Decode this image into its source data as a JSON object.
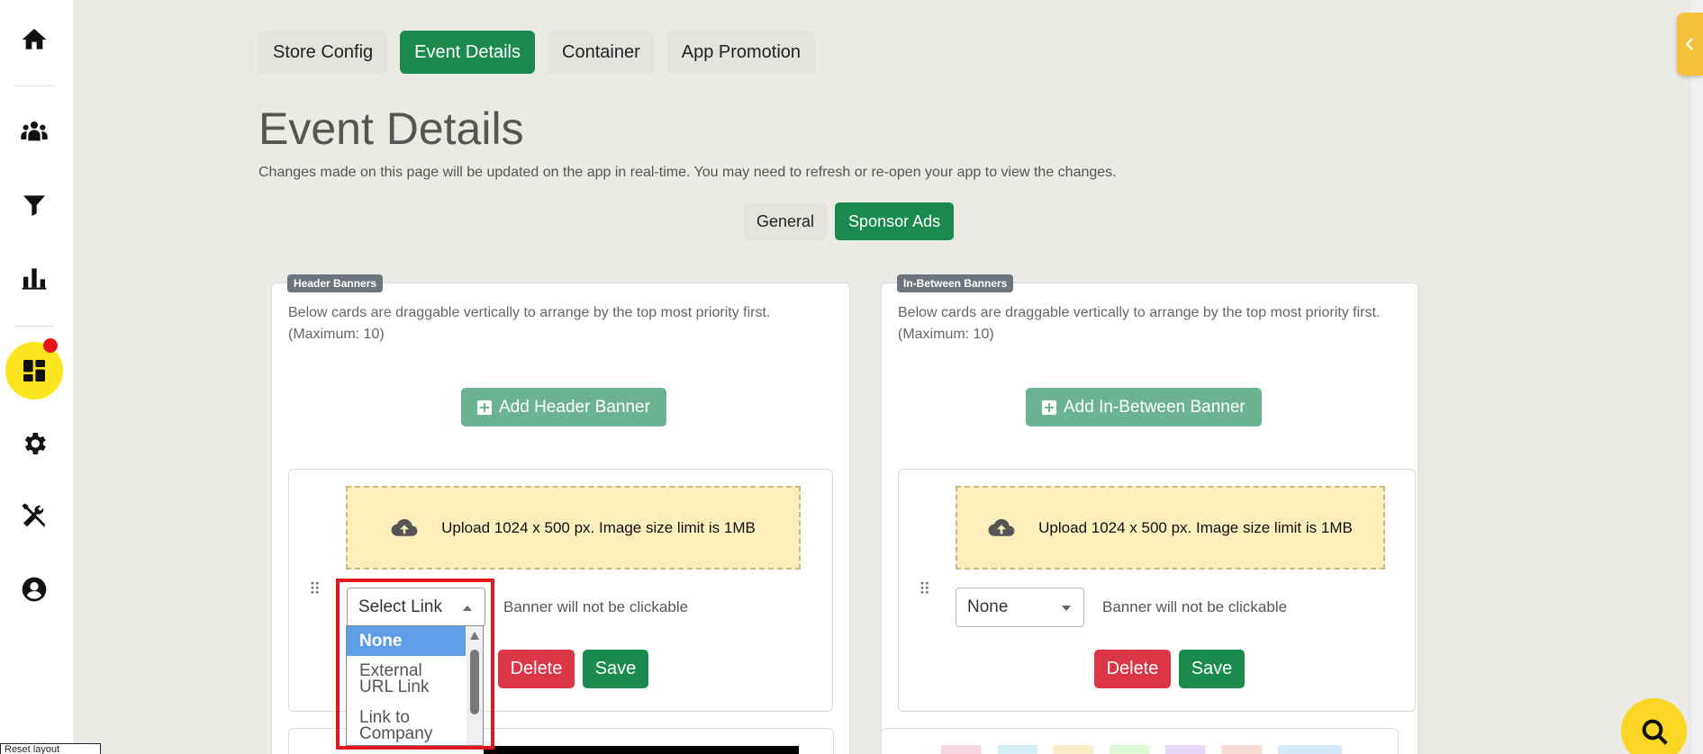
{
  "sidebar": {
    "items": [
      {
        "name": "home-icon"
      },
      {
        "name": "people-group-icon"
      },
      {
        "name": "filter-icon"
      },
      {
        "name": "bar-chart-icon"
      },
      {
        "name": "dashboard-grid-icon",
        "active": true
      },
      {
        "name": "gear-icon"
      },
      {
        "name": "tools-icon"
      },
      {
        "name": "user-circle-icon"
      }
    ]
  },
  "tabs": [
    "Store Config",
    "Event Details",
    "Container",
    "App Promotion"
  ],
  "active_tab": "Event Details",
  "page": {
    "title": "Event Details",
    "subtitle": "Changes made on this page will be updated on the app in real-time. You may need to refresh or re-open your app to view the changes."
  },
  "sub_tabs": [
    "General",
    "Sponsor Ads"
  ],
  "active_sub_tab": "Sponsor Ads",
  "header_banners": {
    "badge": "Header Banners",
    "desc_line1": "Below cards are draggable vertically to arrange by the top most priority first.",
    "desc_line2": "(Maximum: 10)",
    "add_label": "Add Header Banner",
    "card": {
      "upload_text": "Upload 1024 x 500 px. Image size limit is 1MB",
      "select_value": "Select Link",
      "note": "Banner will not be clickable",
      "delete_label": "Delete",
      "save_label": "Save"
    },
    "dropdown_options": [
      {
        "label": "None",
        "selected": true
      },
      {
        "label_line1": "External",
        "label_line2": "URL Link"
      },
      {
        "label_line1": "Link to",
        "label_line2": "Company"
      }
    ]
  },
  "inbetween_banners": {
    "badge": "In-Between Banners",
    "desc_line1": "Below cards are draggable vertically to arrange by the top most priority first.",
    "desc_line2": "(Maximum: 10)",
    "add_label": "Add In-Between Banner",
    "card": {
      "upload_text": "Upload 1024 x 500 px. Image size limit is 1MB",
      "select_value": "None",
      "note": "Banner will not be clickable",
      "delete_label": "Delete",
      "save_label": "Save"
    }
  },
  "colors": {
    "accent_green": "#1b8a4f",
    "sidebar_active": "#fde51f",
    "delete_red": "#dc3545",
    "highlight_red": "#e3161d",
    "upload_bg": "#fdefbb"
  },
  "bottom_chip": "Reset layout"
}
